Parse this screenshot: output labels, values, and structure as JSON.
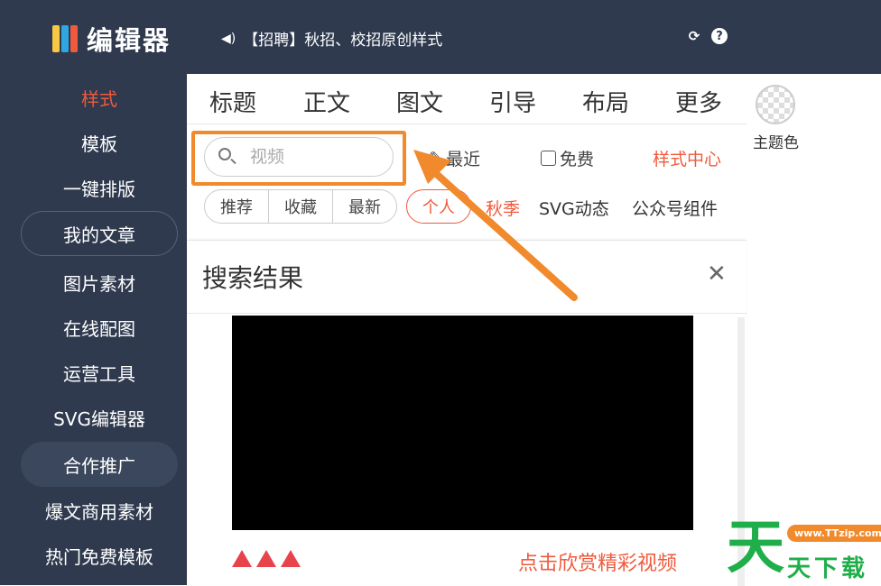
{
  "header": {
    "logo_text": "编辑器",
    "notice": "【招聘】秋招、校招原创样式",
    "icons": [
      "refresh-icon",
      "help-icon"
    ]
  },
  "sidebar": {
    "items": [
      {
        "label": "样式",
        "active": true
      },
      {
        "label": "模板"
      },
      {
        "label": "一键排版"
      },
      {
        "label": "我的文章"
      },
      {
        "label": "图片素材"
      },
      {
        "label": "在线配图"
      },
      {
        "label": "运营工具"
      },
      {
        "label": "SVG编辑器"
      },
      {
        "label": "合作推广"
      },
      {
        "label": "爆文商用素材"
      },
      {
        "label": "热门免费模板"
      }
    ]
  },
  "tabs": [
    "标题",
    "正文",
    "图文",
    "引导",
    "布局",
    "更多"
  ],
  "theme": {
    "label": "主题色"
  },
  "search": {
    "placeholder": "视频"
  },
  "filters": {
    "recent": "最近",
    "free": "免费",
    "style_center": "样式中心"
  },
  "chips": [
    "推荐",
    "收藏",
    "最新",
    "个人"
  ],
  "tags": [
    "秋季",
    "SVG动态",
    "公众号组件"
  ],
  "results": {
    "title": "搜索结果",
    "link": "点击欣赏精彩视频"
  },
  "watermark": {
    "big": "天",
    "url": "www.TTzip.com",
    "text": "天下载"
  },
  "colors": {
    "sidebar_bg": "#2f3a4f",
    "accent": "#f05a3c",
    "highlight": "#f08a2c",
    "watermark": "#1fae4a"
  }
}
